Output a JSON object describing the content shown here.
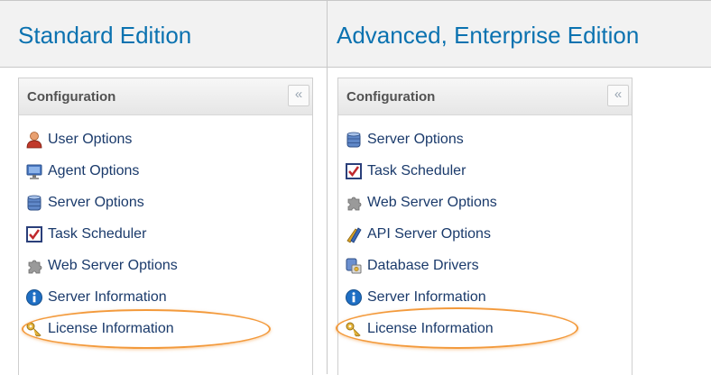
{
  "columns": [
    {
      "heading": "Standard Edition",
      "panel_title": "Configuration",
      "collapse_glyph": "«",
      "items": [
        {
          "label": "User Options",
          "icon": "user-icon"
        },
        {
          "label": "Agent Options",
          "icon": "monitor-icon"
        },
        {
          "label": "Server Options",
          "icon": "database-icon"
        },
        {
          "label": "Task Scheduler",
          "icon": "checklist-icon"
        },
        {
          "label": "Web Server Options",
          "icon": "puzzle-icon"
        },
        {
          "label": "Server Information",
          "icon": "info-icon"
        },
        {
          "label": "License Information",
          "icon": "key-icon"
        }
      ]
    },
    {
      "heading": "Advanced, Enterprise Edition",
      "panel_title": "Configuration",
      "collapse_glyph": "«",
      "items": [
        {
          "label": "Server Options",
          "icon": "database-icon"
        },
        {
          "label": "Task Scheduler",
          "icon": "checklist-icon"
        },
        {
          "label": "Web Server Options",
          "icon": "puzzle-icon"
        },
        {
          "label": "API Server Options",
          "icon": "tools-icon"
        },
        {
          "label": "Database Drivers",
          "icon": "drivers-icon"
        },
        {
          "label": "Server Information",
          "icon": "info-icon"
        },
        {
          "label": "License Information",
          "icon": "key-icon"
        }
      ]
    }
  ],
  "colors": {
    "heading": "#0b72b0",
    "highlight": "#f39a3c",
    "label": "#1a3a6b"
  }
}
